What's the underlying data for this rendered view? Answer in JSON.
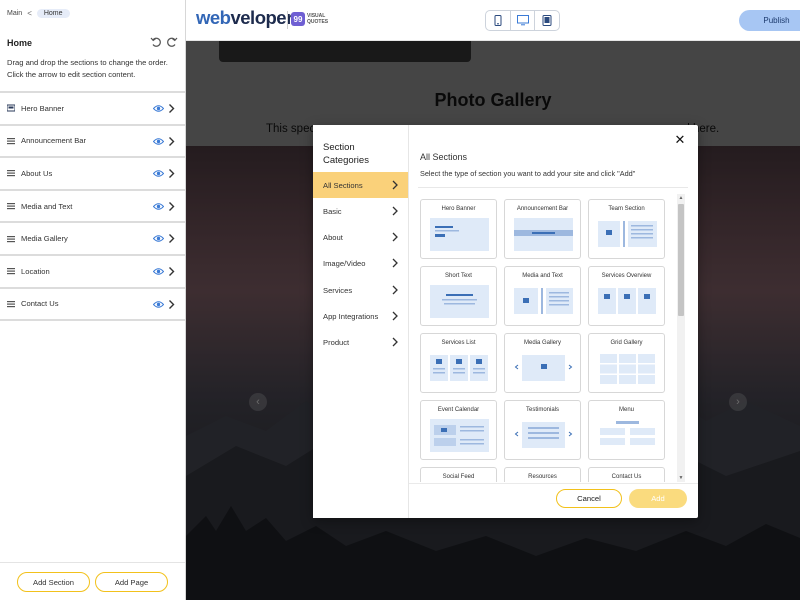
{
  "breadcrumb": {
    "root": "Main",
    "separator": "<",
    "current": "Home"
  },
  "left_panel": {
    "title": "Home",
    "description": "Drag and drop the sections to change the order. Click the arrow to edit section content.",
    "sections": [
      {
        "label": "Hero Banner",
        "icon": "image-icon"
      },
      {
        "label": "Announcement Bar",
        "icon": "drag-handle-icon"
      },
      {
        "label": "About Us",
        "icon": "drag-handle-icon"
      },
      {
        "label": "Media and Text",
        "icon": "drag-handle-icon"
      },
      {
        "label": "Media Gallery",
        "icon": "drag-handle-icon"
      },
      {
        "label": "Location",
        "icon": "drag-handle-icon"
      },
      {
        "label": "Contact Us",
        "icon": "drag-handle-icon"
      }
    ],
    "add_section_label": "Add Section",
    "add_page_label": "Add Page"
  },
  "topbar": {
    "logo_part1": "web",
    "logo_part2": "veloper",
    "partner_badge": "99",
    "partner_line1": "VISUAL",
    "partner_line2": "QUOTES",
    "publish_label": "Publish",
    "devices": [
      "mobile-icon",
      "desktop-icon",
      "tablet-icon"
    ]
  },
  "preview": {
    "gallery_title": "Photo Gallery",
    "subtitle_left": "This spec",
    "subtitle_right": "ed here."
  },
  "modal": {
    "categories_title": "Section Categories",
    "categories": [
      {
        "label": "All Sections",
        "active": true
      },
      {
        "label": "Basic",
        "active": false
      },
      {
        "label": "About",
        "active": false
      },
      {
        "label": "Image/Video",
        "active": false
      },
      {
        "label": "Services",
        "active": false
      },
      {
        "label": "App Integrations",
        "active": false
      },
      {
        "label": "Product",
        "active": false
      }
    ],
    "heading": "All Sections",
    "description": "Select the type of section you want to add your site and click \"Add\"",
    "cards": [
      {
        "label": "Hero Banner",
        "thumb": "hero"
      },
      {
        "label": "Announcement Bar",
        "thumb": "announce"
      },
      {
        "label": "Team Section",
        "thumb": "team"
      },
      {
        "label": "Short Text",
        "thumb": "shorttext"
      },
      {
        "label": "Media and Text",
        "thumb": "mediatext"
      },
      {
        "label": "Services Overview",
        "thumb": "services3"
      },
      {
        "label": "Services List",
        "thumb": "serviceslist"
      },
      {
        "label": "Media Gallery",
        "thumb": "gallery"
      },
      {
        "label": "Grid Gallery",
        "thumb": "grid"
      },
      {
        "label": "Event Calendar",
        "thumb": "calendar"
      },
      {
        "label": "Testimonials",
        "thumb": "testimonials"
      },
      {
        "label": "Menu",
        "thumb": "menu"
      },
      {
        "label": "Social Feed",
        "thumb": "none"
      },
      {
        "label": "Resources",
        "thumb": "none"
      },
      {
        "label": "Contact Us",
        "thumb": "none"
      }
    ],
    "cancel_label": "Cancel",
    "add_label": "Add",
    "close_symbol": "✕"
  },
  "colors": {
    "accent_yellow": "#f2c11b",
    "active_category": "#fad17a",
    "publish_bg": "#a7c6f3",
    "thumb_fill": "#dfeaf8",
    "thumb_dark": "#3b6fb6",
    "brand_blue": "#3266b6"
  }
}
